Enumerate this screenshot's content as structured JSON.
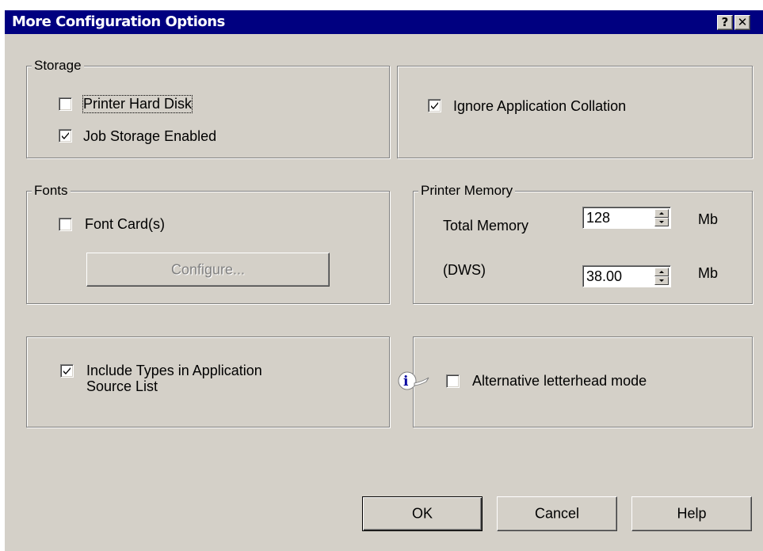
{
  "window": {
    "title": "More Configuration Options",
    "help_glyph": "?",
    "close_glyph": "✕"
  },
  "storage": {
    "legend": "Storage",
    "printer_hard_disk": {
      "label": "Printer Hard Disk",
      "checked": false
    },
    "job_storage": {
      "label": "Job Storage Enabled",
      "checked": true
    }
  },
  "ignore_collation": {
    "label": "Ignore Application Collation",
    "checked": true
  },
  "fonts": {
    "legend": "Fonts",
    "font_cards": {
      "label": "Font Card(s)",
      "checked": false
    },
    "configure_button": "Configure..."
  },
  "memory": {
    "legend": "Printer Memory",
    "total": {
      "label": "Total Memory",
      "value": "128",
      "unit": "Mb"
    },
    "dws": {
      "label": "(DWS)",
      "value": "38.00",
      "unit": "Mb"
    }
  },
  "include_types": {
    "label_line1": "Include Types in Application",
    "label_line2": "Source List",
    "checked": true
  },
  "letterhead": {
    "label": "Alternative letterhead mode",
    "checked": false,
    "info_glyph": "i"
  },
  "buttons": {
    "ok": "OK",
    "cancel": "Cancel",
    "help": "Help"
  }
}
